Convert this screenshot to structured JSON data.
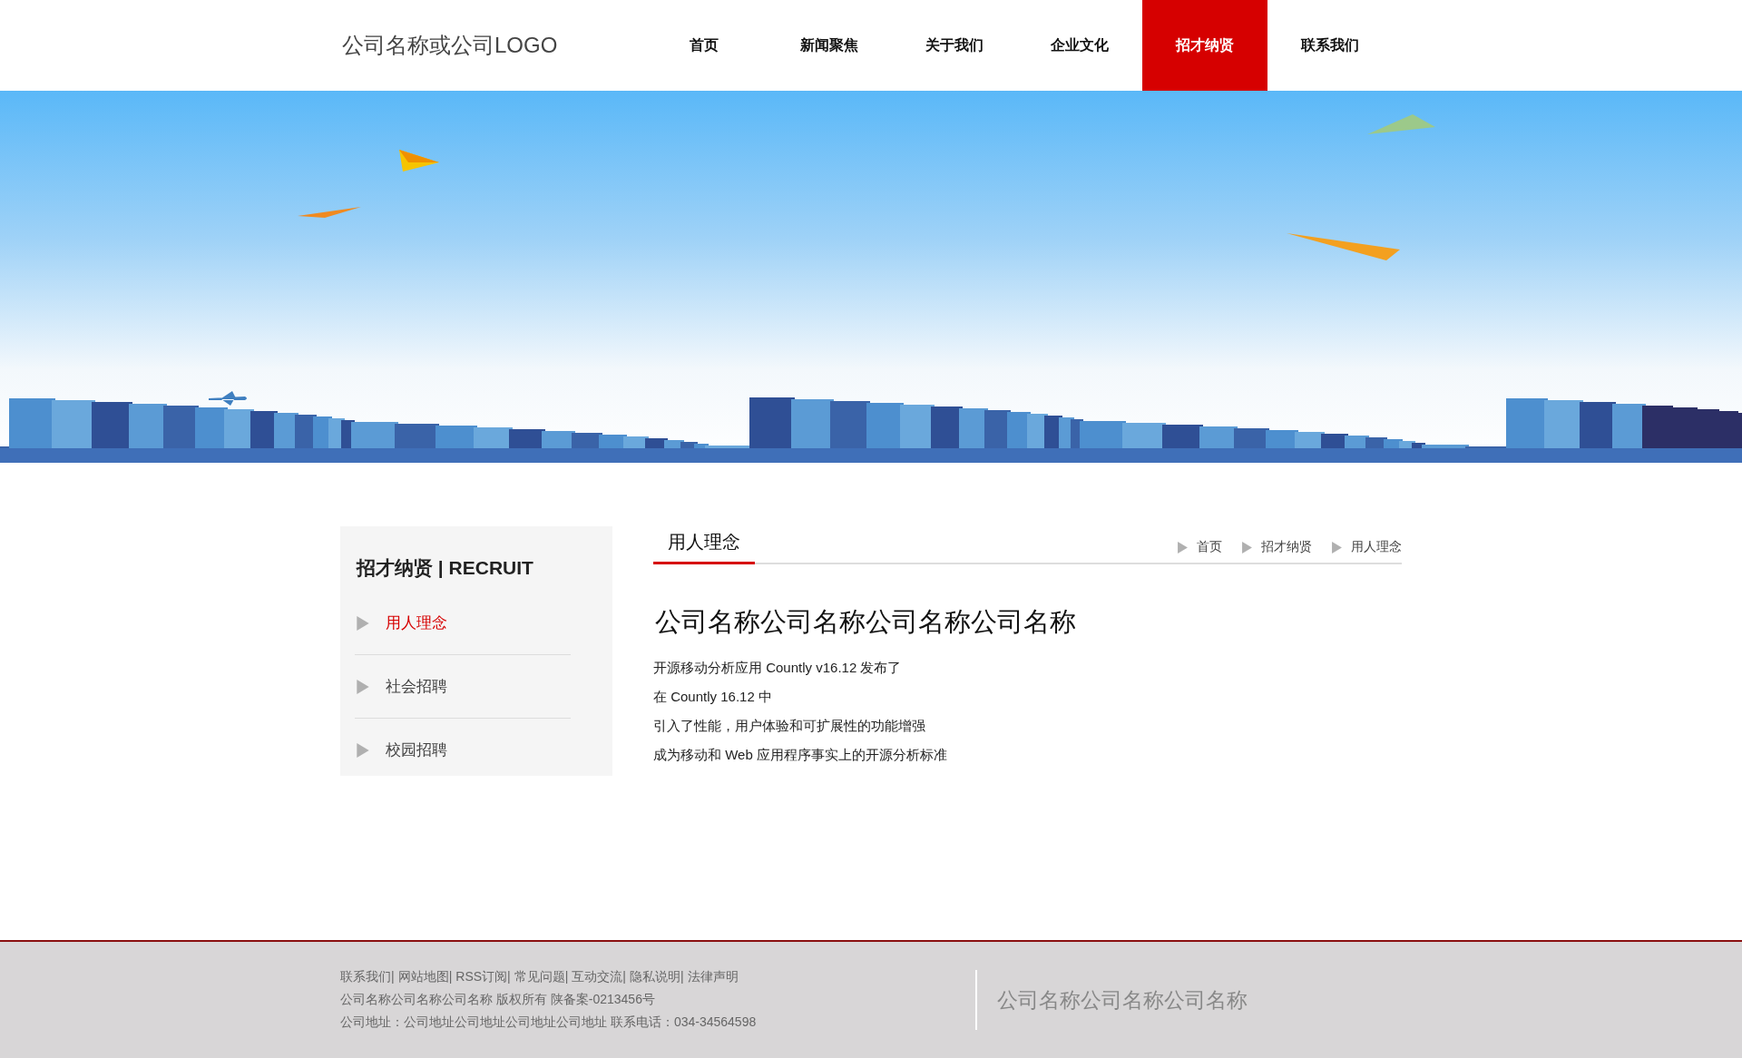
{
  "header": {
    "logo": "公司名称或公司LOGO",
    "nav": [
      {
        "label": "首页",
        "selected": false
      },
      {
        "label": "新闻聚焦",
        "selected": false
      },
      {
        "label": "关于我们",
        "selected": false
      },
      {
        "label": "企业文化",
        "selected": false
      },
      {
        "label": "招才纳贤",
        "selected": true
      },
      {
        "label": "联系我们",
        "selected": false
      }
    ]
  },
  "sidebar": {
    "title": "招才纳贤 | RECRUIT",
    "items": [
      {
        "label": "用人理念",
        "selected": true
      },
      {
        "label": "社会招聘",
        "selected": false
      },
      {
        "label": "校园招聘",
        "selected": false
      }
    ]
  },
  "content": {
    "tab": "用人理念",
    "breadcrumb": [
      "首页",
      "招才纳贤",
      "用人理念"
    ],
    "heading": "公司名称公司名称公司名称公司名称",
    "paragraphs": [
      "开源移动分析应用 Countly v16.12 发布了",
      "在 Countly 16.12 中",
      "引入了性能，用户体验和可扩展性的功能增强",
      "成为移动和 Web 应用程序事实上的开源分析标准"
    ]
  },
  "footer": {
    "links": [
      "联系我们|",
      "网站地图|",
      "RSS订阅|",
      "常见问题|",
      "互动交流|",
      "隐私说明|",
      "法律声明"
    ],
    "copyright": "公司名称公司名称公司名称 版权所有 陕备案-0213456号",
    "address": "公司地址：公司地址公司地址公司地址公司地址 联系电话：034-34564598",
    "company": "公司名称公司名称公司名称"
  }
}
